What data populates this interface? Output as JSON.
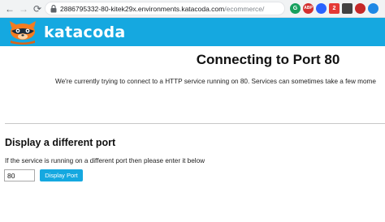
{
  "browser": {
    "url_host": "2886795332-80-kitek29x.environments.katacoda.com",
    "url_path": "/ecommerce/",
    "back_icon": "arrow-left-icon",
    "forward_icon": "arrow-right-icon",
    "reload_icon": "reload-icon",
    "bookmark_icon": "star-icon",
    "extensions": [
      {
        "label": "G",
        "color": "#17a05d"
      },
      {
        "label": "ABP",
        "color": "#d32f2f"
      },
      {
        "label": "•",
        "color": "#2962ff"
      },
      {
        "label": "2",
        "color": "#e53935"
      },
      {
        "label": "■",
        "color": "#424242"
      },
      {
        "label": "◆",
        "color": "#c62828"
      },
      {
        "label": "●",
        "color": "#1e88e5"
      },
      {
        "label": "●",
        "color": "#ef6c00"
      }
    ]
  },
  "brand": {
    "name": "katacoda",
    "color": "#15a8e0"
  },
  "main": {
    "heading": "Connecting to Port 80",
    "message": "We're currently trying to connect to a HTTP service running on 80. Services can sometimes take a few mome",
    "subheading": "Display a different port",
    "instructions": "If the service is running on a different port then please enter it below",
    "port_value": "80",
    "button_label": "Display Port"
  }
}
